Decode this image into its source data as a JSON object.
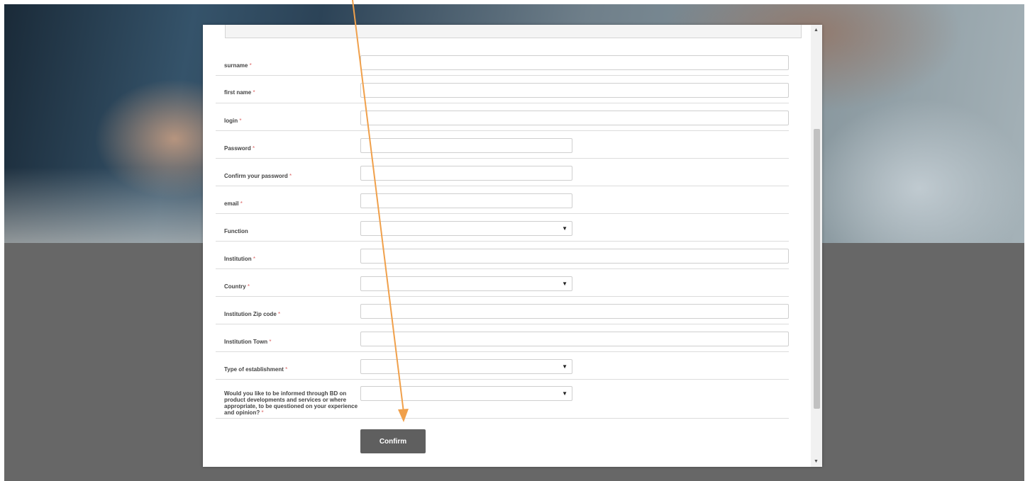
{
  "form": {
    "fields": [
      {
        "label": "surname",
        "required": "*"
      },
      {
        "label": "first name",
        "required": "*"
      },
      {
        "label": "login",
        "required": "*"
      },
      {
        "label": "Password",
        "required": "*"
      },
      {
        "label": "Confirm your password",
        "required": "*"
      },
      {
        "label": "email",
        "required": "*"
      },
      {
        "label": "Function",
        "required": ""
      },
      {
        "label": "Institution",
        "required": "*"
      },
      {
        "label": "Country",
        "required": "*"
      },
      {
        "label": "Institution Zip code",
        "required": "*"
      },
      {
        "label": "Institution Town",
        "required": "*"
      },
      {
        "label": "Type of establishment",
        "required": "*"
      },
      {
        "label": "Would you like to be informed through BD on product developments and services or where appropriate, to be questioned on your experience and opinion?",
        "required": "*"
      }
    ],
    "select_arrow": "▼",
    "confirm_label": "Confirm"
  },
  "scrollbar": {
    "up": "▲",
    "down": "▼"
  },
  "colors": {
    "annotation_arrow": "#f0a04b",
    "button": "#5f5f5f",
    "backdrop": "#676767"
  }
}
